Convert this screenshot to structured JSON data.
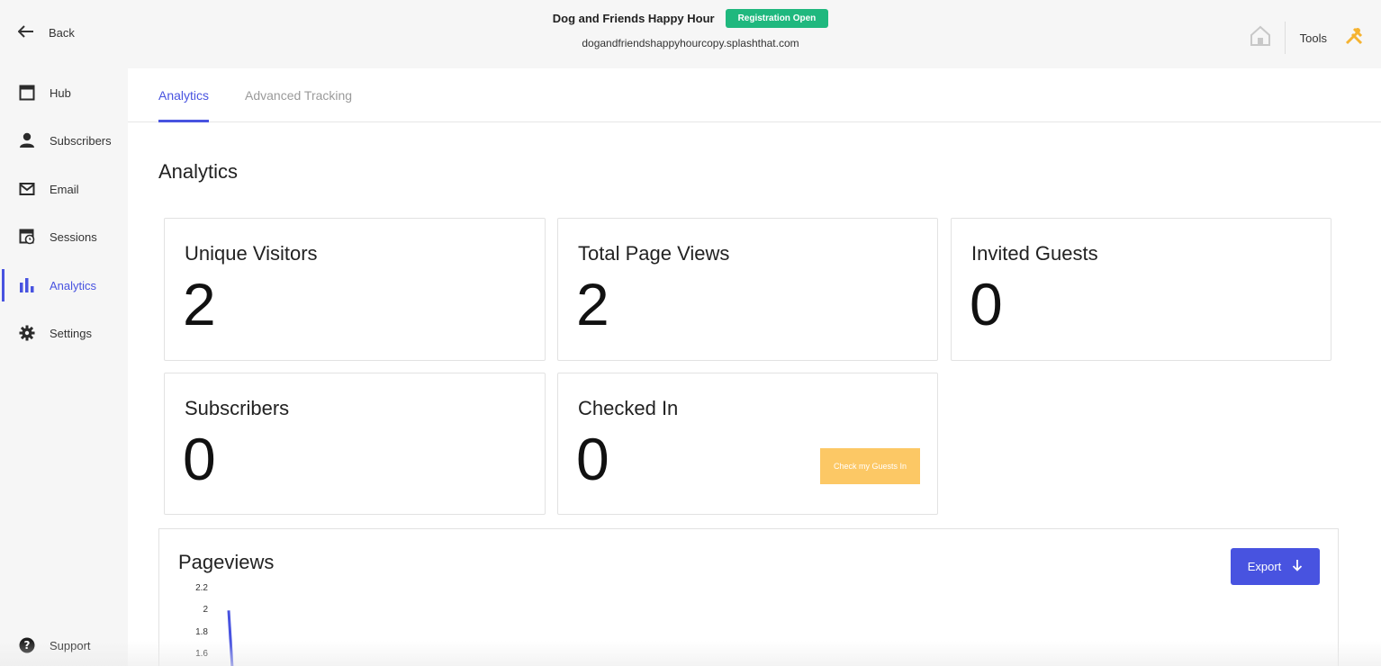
{
  "topbar": {
    "back_label": "Back",
    "event_title": "Dog and Friends Happy Hour",
    "status_badge": "Registration Open",
    "event_url": "dogandfriendshappyhourcopy.splashthat.com",
    "tools_label": "Tools"
  },
  "sidebar": {
    "items": [
      {
        "label": "Hub",
        "icon": "hub-icon"
      },
      {
        "label": "Subscribers",
        "icon": "person-icon"
      },
      {
        "label": "Email",
        "icon": "envelope-icon"
      },
      {
        "label": "Sessions",
        "icon": "calendar-clock-icon"
      },
      {
        "label": "Analytics",
        "icon": "bar-chart-icon",
        "active": true
      },
      {
        "label": "Settings",
        "icon": "gear-icon"
      }
    ],
    "support_label": "Support"
  },
  "tabs": [
    {
      "label": "Analytics",
      "active": true
    },
    {
      "label": "Advanced Tracking",
      "active": false
    }
  ],
  "page_title": "Analytics",
  "stats": [
    {
      "label": "Unique Visitors",
      "value": "2"
    },
    {
      "label": "Total Page Views",
      "value": "2"
    },
    {
      "label": "Invited Guests",
      "value": "0"
    },
    {
      "label": "Subscribers",
      "value": "0"
    },
    {
      "label": "Checked In",
      "value": "0"
    }
  ],
  "checkin_button_label": "Check my Guests In",
  "pageviews": {
    "title": "Pageviews",
    "export_label": "Export"
  },
  "chart_data": {
    "type": "line",
    "title": "Pageviews",
    "y_ticks": [
      "2.2",
      "2",
      "1.8",
      "1.6"
    ],
    "series": [
      {
        "values": [
          2
        ]
      }
    ]
  },
  "colors": {
    "accent": "#4853e0",
    "badge_green": "#1fb87e",
    "checkin_yellow": "#fcc865",
    "tools_orange": "#f5b331"
  }
}
